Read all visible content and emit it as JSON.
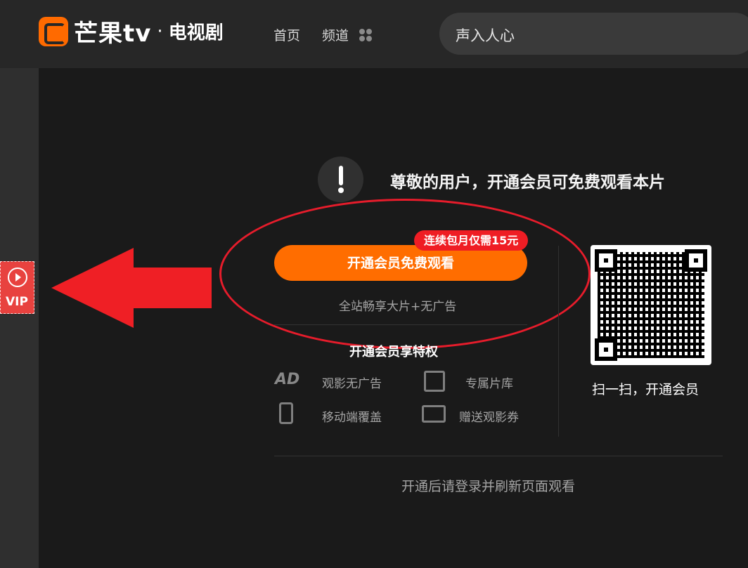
{
  "header": {
    "logo_text": "芒果tv",
    "logo_separator": "·",
    "logo_subtitle": "电视剧",
    "nav": [
      "首页",
      "频道"
    ],
    "search_placeholder": "声入人心"
  },
  "sidebar": {
    "vip_label": "VIP"
  },
  "paywall": {
    "notice": "尊敬的用户，开通会员可免费观看本片",
    "button_label": "开通会员免费观看",
    "price_badge": "连续包月仅需15元",
    "subtext": "全站畅享大片+无广告",
    "privilege_title": "开通会员享特权",
    "privileges": [
      {
        "icon": "ad-free-icon",
        "label": "观影无广告"
      },
      {
        "icon": "film-library-icon",
        "label": "专属片库"
      },
      {
        "icon": "mobile-icon",
        "label": "移动端覆盖"
      },
      {
        "icon": "ticket-icon",
        "label": "赠送观影券"
      }
    ],
    "qr_caption": "扫一扫，开通会员",
    "footer_text": "开通后请登录并刷新页面观看"
  },
  "colors": {
    "accent": "#ff6d00",
    "badge": "#ef1d24",
    "annotation_red": "#ef1f25"
  }
}
